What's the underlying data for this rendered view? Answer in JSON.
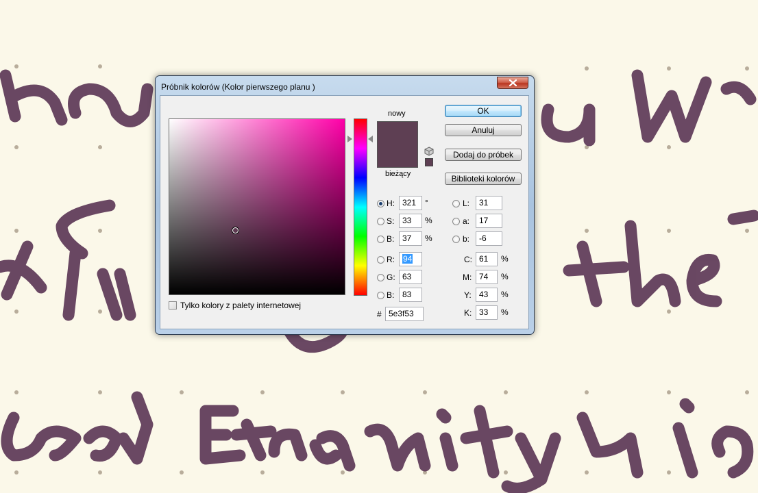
{
  "dialog": {
    "title": "Próbnik kolorów (Kolor pierwszego planu )",
    "label_new": "nowy",
    "label_current": "bieżący",
    "color_new": "#5e3f53",
    "color_current": "#5e3f53",
    "buttons": {
      "ok": "OK",
      "cancel": "Anuluj",
      "add_swatch": "Dodaj do próbek",
      "libraries": "Biblioteki kolorów"
    },
    "web_colors_label": "Tylko kolory z palety internetowej",
    "hsb": {
      "h_label": "H:",
      "h_value": "321",
      "h_unit": "°",
      "s_label": "S:",
      "s_value": "33",
      "s_unit": "%",
      "b_label": "B:",
      "b_value": "37",
      "b_unit": "%"
    },
    "rgb": {
      "r_label": "R:",
      "r_value": "94",
      "g_label": "G:",
      "g_value": "63",
      "b_label": "B:",
      "b_value": "83"
    },
    "hex": {
      "label": "#",
      "value": "5e3f53"
    },
    "lab": {
      "l_label": "L:",
      "l_value": "31",
      "a_label": "a:",
      "a_value": "17",
      "b_label": "b:",
      "b_value": "-6"
    },
    "cmyk": {
      "c_label": "C:",
      "c_value": "61",
      "m_label": "M:",
      "m_value": "74",
      "y_label": "Y:",
      "y_value": "43",
      "k_label": "K:",
      "k_value": "33",
      "unit": "%"
    },
    "accent_field_hue": "#ff00a8"
  },
  "background": {
    "paper_color": "#fbf8e9",
    "ink_color": "#5a3454",
    "handwriting_lines": [
      "Hea... a w",
      "nfi... the",
      "and Eternity i"
    ]
  }
}
